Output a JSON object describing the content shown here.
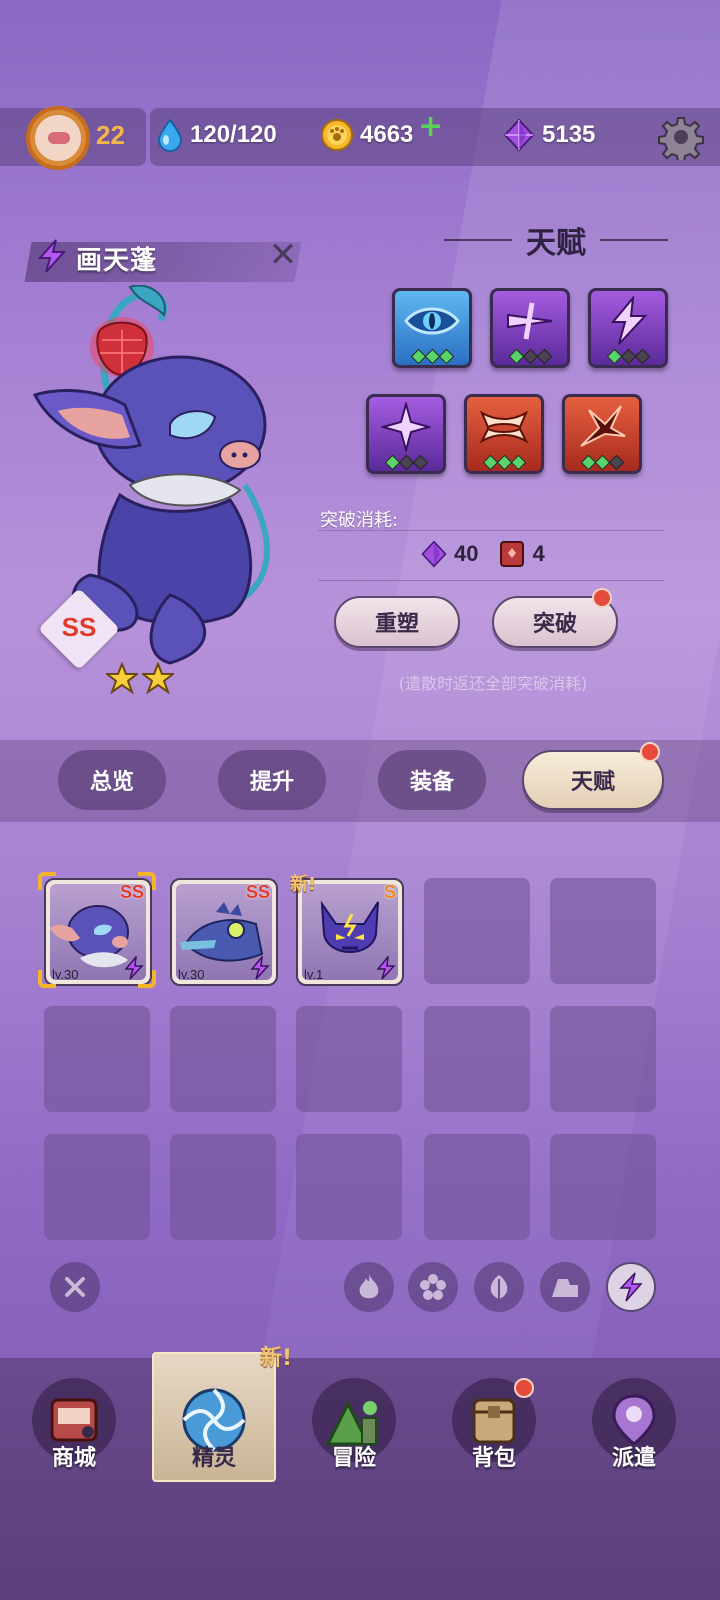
{
  "player": {
    "level": "22"
  },
  "resources": {
    "energy": "120/120",
    "coins": "4663",
    "gems": "5135"
  },
  "creature": {
    "name": "画天蓬",
    "rank": "SS",
    "stars": 2
  },
  "talent": {
    "title": "天赋",
    "skills": [
      {
        "icon": "eye-icon",
        "color": "#3a8ee0",
        "level": 3
      },
      {
        "icon": "slash-icon",
        "color": "#8a44c8",
        "level": 1
      },
      {
        "icon": "lightning-icon",
        "color": "#8a44c8",
        "level": 1
      },
      {
        "icon": "sparkle-icon",
        "color": "#8a44c8",
        "level": 1
      },
      {
        "icon": "fang-icon",
        "color": "#d84a30",
        "level": 3
      },
      {
        "icon": "burst-icon",
        "color": "#d84a30",
        "level": 2
      }
    ],
    "cost_label": "突破消耗:",
    "cost_gem": "40",
    "cost_book": "4",
    "reset_label": "重塑",
    "breakthrough_label": "突破",
    "hint": "(遣散时返还全部突破消耗)"
  },
  "tabs": [
    {
      "label": "总览"
    },
    {
      "label": "提升"
    },
    {
      "label": "装备"
    },
    {
      "label": "天赋"
    }
  ],
  "roster": [
    {
      "level": "lv.30",
      "rank": "SS",
      "selected": true
    },
    {
      "level": "lv.30",
      "rank": "SS"
    },
    {
      "level": "lv.1",
      "rank": "S",
      "new_label": "新!"
    }
  ],
  "filters": [
    "close-icon",
    "fire-icon",
    "flower-icon",
    "leaf-icon",
    "rock-icon",
    "lightning-icon"
  ],
  "nav": {
    "new_label": "新!",
    "items": [
      {
        "label": "商城"
      },
      {
        "label": "精灵"
      },
      {
        "label": "冒险"
      },
      {
        "label": "背包"
      },
      {
        "label": "派遣"
      }
    ]
  }
}
